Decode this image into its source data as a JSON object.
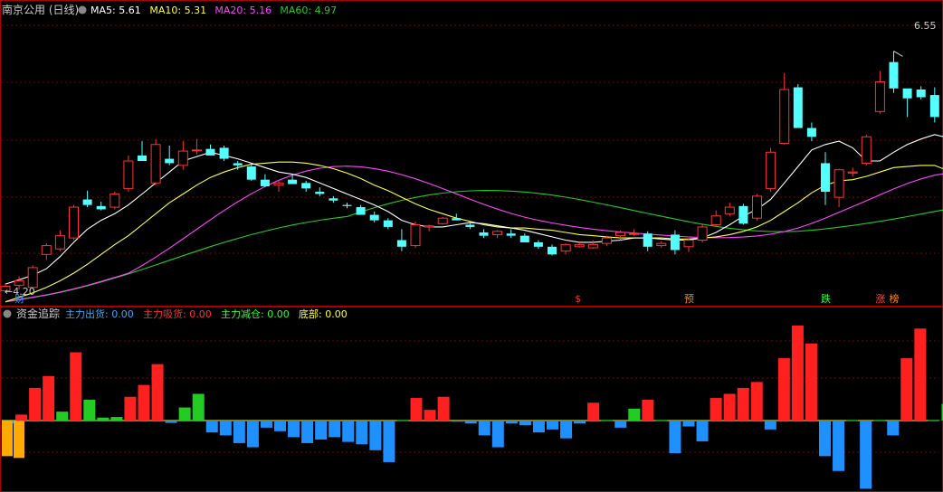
{
  "top_panel": {
    "title": "南京公用 (日线)",
    "ma": [
      {
        "label": "MA5: 5.61",
        "color": "#ffffff"
      },
      {
        "label": "MA10: 5.31",
        "color": "#ffff44"
      },
      {
        "label": "MA20: 5.16",
        "color": "#ff44ff"
      },
      {
        "label": "MA60: 4.97",
        "color": "#22cc22"
      }
    ],
    "high_label": "6.55",
    "low_label": "4.20",
    "signals": [
      {
        "text": "财",
        "color": "#3399ff",
        "index": 1
      },
      {
        "text": "$",
        "color": "#ff3333",
        "index": 42
      },
      {
        "text": "预",
        "color": "#ff8800",
        "index": 50
      },
      {
        "text": "跌",
        "color": "#33ff33",
        "index": 60
      },
      {
        "text": "涨",
        "color": "#ff4444",
        "index": 64
      },
      {
        "text": "榜",
        "color": "#ff8800",
        "index": 65
      }
    ]
  },
  "bottom_panel": {
    "title": "资金追踪",
    "legend": [
      {
        "label": "主力出货: 0.00",
        "color": "#33aaff"
      },
      {
        "label": "主力吸货: 0.00",
        "color": "#ff3333"
      },
      {
        "label": "主力减仓: 0.00",
        "color": "#33ff33"
      },
      {
        "label": "底部: 0.00",
        "color": "#ffff44"
      }
    ]
  },
  "colors": {
    "up": "#ff3333",
    "down": "#54ffff",
    "grid": "#7a0000",
    "ma5": "#ffffff",
    "ma10": "#ffff44",
    "ma20": "#ff44ff",
    "ma60": "#22cc22",
    "flow_red": "#ff2020",
    "flow_blue": "#1e90ff",
    "flow_green": "#22cc22",
    "flow_orange": "#ffaa00"
  },
  "chart_data": [
    {
      "type": "candlestick",
      "title": "南京公用 (日线)",
      "ylim": [
        4.1,
        6.7
      ],
      "candles": [
        [
          4.22,
          4.29,
          4.2,
          4.26
        ],
        [
          4.27,
          4.35,
          4.23,
          4.31
        ],
        [
          4.25,
          4.45,
          4.24,
          4.43
        ],
        [
          4.55,
          4.65,
          4.5,
          4.63
        ],
        [
          4.6,
          4.77,
          4.58,
          4.72
        ],
        [
          4.7,
          5.0,
          4.68,
          4.98
        ],
        [
          5.05,
          5.13,
          4.98,
          5.0
        ],
        [
          4.99,
          5.03,
          4.95,
          4.96
        ],
        [
          4.98,
          5.12,
          4.96,
          5.1
        ],
        [
          5.15,
          5.45,
          5.12,
          5.4
        ],
        [
          5.45,
          5.58,
          5.4,
          5.4
        ],
        [
          5.2,
          5.6,
          5.18,
          5.55
        ],
        [
          5.42,
          5.54,
          5.36,
          5.38
        ],
        [
          5.36,
          5.58,
          5.32,
          5.49
        ],
        [
          5.5,
          5.6,
          5.46,
          5.5
        ],
        [
          5.51,
          5.55,
          5.45,
          5.45
        ],
        [
          5.52,
          5.54,
          5.4,
          5.42
        ],
        [
          5.38,
          5.4,
          5.32,
          5.36
        ],
        [
          5.35,
          5.37,
          5.22,
          5.23
        ],
        [
          5.23,
          5.28,
          5.16,
          5.17
        ],
        [
          5.18,
          5.22,
          5.12,
          5.2
        ],
        [
          5.23,
          5.28,
          5.19,
          5.19
        ],
        [
          5.2,
          5.22,
          5.12,
          5.15
        ],
        [
          5.12,
          5.16,
          5.08,
          5.1
        ],
        [
          5.06,
          5.08,
          5.02,
          5.04
        ],
        [
          5.0,
          5.02,
          4.97,
          4.99
        ],
        [
          4.98,
          5.0,
          4.94,
          4.91
        ],
        [
          4.91,
          4.94,
          4.84,
          4.86
        ],
        [
          4.86,
          4.88,
          4.78,
          4.8
        ],
        [
          4.68,
          4.78,
          4.58,
          4.62
        ],
        [
          4.63,
          4.85,
          4.61,
          4.82
        ],
        [
          4.8,
          4.82,
          4.76,
          4.81
        ],
        [
          4.83,
          4.89,
          4.82,
          4.88
        ],
        [
          4.88,
          4.92,
          4.86,
          4.86
        ],
        [
          4.82,
          4.85,
          4.78,
          4.8
        ],
        [
          4.75,
          4.78,
          4.7,
          4.72
        ],
        [
          4.73,
          4.77,
          4.7,
          4.76
        ],
        [
          4.74,
          4.78,
          4.7,
          4.72
        ],
        [
          4.72,
          4.74,
          4.66,
          4.66
        ],
        [
          4.66,
          4.68,
          4.6,
          4.62
        ],
        [
          4.62,
          4.64,
          4.54,
          4.55
        ],
        [
          4.58,
          4.65,
          4.55,
          4.64
        ],
        [
          4.62,
          4.66,
          4.61,
          4.64
        ],
        [
          4.61,
          4.68,
          4.6,
          4.64
        ],
        [
          4.65,
          4.72,
          4.63,
          4.7
        ],
        [
          4.72,
          4.77,
          4.68,
          4.75
        ],
        [
          4.74,
          4.78,
          4.72,
          4.74
        ],
        [
          4.74,
          4.76,
          4.58,
          4.62
        ],
        [
          4.63,
          4.67,
          4.61,
          4.65
        ],
        [
          4.73,
          4.77,
          4.55,
          4.59
        ],
        [
          4.62,
          4.7,
          4.57,
          4.68
        ],
        [
          4.68,
          4.82,
          4.66,
          4.8
        ],
        [
          4.82,
          4.95,
          4.8,
          4.9
        ],
        [
          4.92,
          5.02,
          4.9,
          4.98
        ],
        [
          4.99,
          5.01,
          4.82,
          4.83
        ],
        [
          4.88,
          5.1,
          4.86,
          5.08
        ],
        [
          5.15,
          5.52,
          5.12,
          5.48
        ],
        [
          5.56,
          6.2,
          5.55,
          6.05
        ],
        [
          6.07,
          6.1,
          5.7,
          5.7
        ],
        [
          5.7,
          5.75,
          5.58,
          5.62
        ],
        [
          5.38,
          5.48,
          5.0,
          5.12
        ],
        [
          5.07,
          5.33,
          4.98,
          5.32
        ],
        [
          5.29,
          5.34,
          5.26,
          5.3
        ],
        [
          5.38,
          5.64,
          5.36,
          5.62
        ],
        [
          5.85,
          6.22,
          5.83,
          6.12
        ],
        [
          6.3,
          6.4,
          6.02,
          6.06
        ],
        [
          6.06,
          6.03,
          5.8,
          5.97
        ],
        [
          6.05,
          6.08,
          5.96,
          5.98
        ],
        [
          6.0,
          6.07,
          5.75,
          5.8
        ]
      ],
      "ma5": [
        4.28,
        4.32,
        4.36,
        4.42,
        4.53,
        4.66,
        4.78,
        4.86,
        4.92,
        5.0,
        5.1,
        5.2,
        5.3,
        5.4,
        5.44,
        5.48,
        5.45,
        5.42,
        5.38,
        5.34,
        5.3,
        5.28,
        5.25,
        5.2,
        5.15,
        5.1,
        5.05,
        5.0,
        4.94,
        4.86,
        4.82,
        4.8,
        4.8,
        4.82,
        4.84,
        4.83,
        4.81,
        4.79,
        4.77,
        4.74,
        4.71,
        4.68,
        4.66,
        4.66,
        4.67,
        4.68,
        4.7,
        4.7,
        4.69,
        4.68,
        4.68,
        4.7,
        4.75,
        4.82,
        4.9,
        4.96,
        5.05,
        5.2,
        5.35,
        5.5,
        5.55,
        5.58,
        5.52,
        5.4,
        5.4,
        5.48,
        5.55,
        5.6,
        5.64,
        5.61
      ],
      "ma10": [
        4.12,
        4.16,
        4.2,
        4.25,
        4.31,
        4.38,
        4.46,
        4.55,
        4.64,
        4.72,
        4.82,
        4.92,
        5.02,
        5.1,
        5.18,
        5.25,
        5.3,
        5.34,
        5.37,
        5.38,
        5.39,
        5.39,
        5.38,
        5.36,
        5.33,
        5.29,
        5.24,
        5.18,
        5.13,
        5.07,
        5.01,
        4.96,
        4.92,
        4.88,
        4.85,
        4.82,
        4.8,
        4.79,
        4.79,
        4.78,
        4.77,
        4.75,
        4.73,
        4.72,
        4.71,
        4.7,
        4.7,
        4.7,
        4.7,
        4.69,
        4.69,
        4.7,
        4.71,
        4.73,
        4.76,
        4.8,
        4.86,
        4.94,
        5.02,
        5.11,
        5.18,
        5.22,
        5.23,
        5.26,
        5.3,
        5.34,
        5.35,
        5.36,
        5.36,
        5.31
      ]
    },
    {
      "type": "bar",
      "title": "资金追踪",
      "series_names": [
        "主力出货",
        "主力吸货",
        "主力减仓",
        "底部"
      ],
      "ylim": [
        -1.1,
        1.6
      ],
      "bars": [
        [
          -0.05,
          "flow_blue"
        ],
        [
          0.1,
          "flow_red"
        ],
        [
          0.55,
          "flow_red"
        ],
        [
          0.75,
          "flow_red"
        ],
        [
          0.15,
          "flow_green"
        ],
        [
          1.15,
          "flow_red"
        ],
        [
          0.35,
          "flow_green"
        ],
        [
          0.05,
          "flow_green"
        ],
        [
          0.06,
          "flow_green"
        ],
        [
          0.4,
          "flow_red"
        ],
        [
          0.6,
          "flow_red"
        ],
        [
          0.95,
          "flow_red"
        ],
        [
          -0.04,
          "flow_blue"
        ],
        [
          0.22,
          "flow_green"
        ],
        [
          0.45,
          "flow_green"
        ],
        [
          -0.2,
          "flow_blue"
        ],
        [
          -0.25,
          "flow_blue"
        ],
        [
          -0.38,
          "flow_blue"
        ],
        [
          -0.45,
          "flow_blue"
        ],
        [
          -0.12,
          "flow_blue"
        ],
        [
          -0.18,
          "flow_blue"
        ],
        [
          -0.28,
          "flow_blue"
        ],
        [
          -0.38,
          "flow_blue"
        ],
        [
          -0.32,
          "flow_blue"
        ],
        [
          -0.28,
          "flow_blue"
        ],
        [
          -0.36,
          "flow_blue"
        ],
        [
          -0.4,
          "flow_blue"
        ],
        [
          -0.5,
          "flow_blue"
        ],
        [
          -0.7,
          "flow_blue"
        ],
        [
          0.01,
          "flow_green"
        ],
        [
          0.38,
          "flow_red"
        ],
        [
          0.18,
          "flow_red"
        ],
        [
          0.4,
          "flow_red"
        ],
        [
          -0.02,
          "flow_blue"
        ],
        [
          -0.05,
          "flow_blue"
        ],
        [
          -0.25,
          "flow_blue"
        ],
        [
          -0.45,
          "flow_blue"
        ],
        [
          -0.05,
          "flow_blue"
        ],
        [
          -0.08,
          "flow_blue"
        ],
        [
          -0.2,
          "flow_blue"
        ],
        [
          -0.15,
          "flow_blue"
        ],
        [
          -0.3,
          "flow_blue"
        ],
        [
          -0.05,
          "flow_blue"
        ],
        [
          0.3,
          "flow_red"
        ],
        [
          0.01,
          "flow_green"
        ],
        [
          -0.12,
          "flow_blue"
        ],
        [
          0.2,
          "flow_green"
        ],
        [
          0.35,
          "flow_red"
        ],
        [
          0.01,
          "flow_green"
        ],
        [
          -0.55,
          "flow_blue"
        ],
        [
          -0.1,
          "flow_blue"
        ],
        [
          -0.35,
          "flow_blue"
        ],
        [
          0.38,
          "flow_red"
        ],
        [
          0.45,
          "flow_red"
        ],
        [
          0.55,
          "flow_red"
        ],
        [
          0.65,
          "flow_red"
        ],
        [
          -0.15,
          "flow_blue"
        ],
        [
          1.05,
          "flow_red"
        ],
        [
          1.6,
          "flow_red"
        ],
        [
          1.3,
          "flow_red"
        ],
        [
          -0.6,
          "flow_blue"
        ],
        [
          -0.85,
          "flow_blue"
        ],
        [
          0.01,
          "flow_green"
        ],
        [
          -1.15,
          "flow_blue"
        ],
        [
          0.01,
          "flow_green"
        ],
        [
          -0.25,
          "flow_blue"
        ],
        [
          1.05,
          "flow_red"
        ],
        [
          1.55,
          "flow_red"
        ],
        [
          0.01,
          "flow_green"
        ],
        [
          0.28,
          "flow_green"
        ],
        [
          -0.5,
          "flow_blue"
        ]
      ],
      "base_bars": [
        -0.4,
        -0.42
      ]
    }
  ]
}
